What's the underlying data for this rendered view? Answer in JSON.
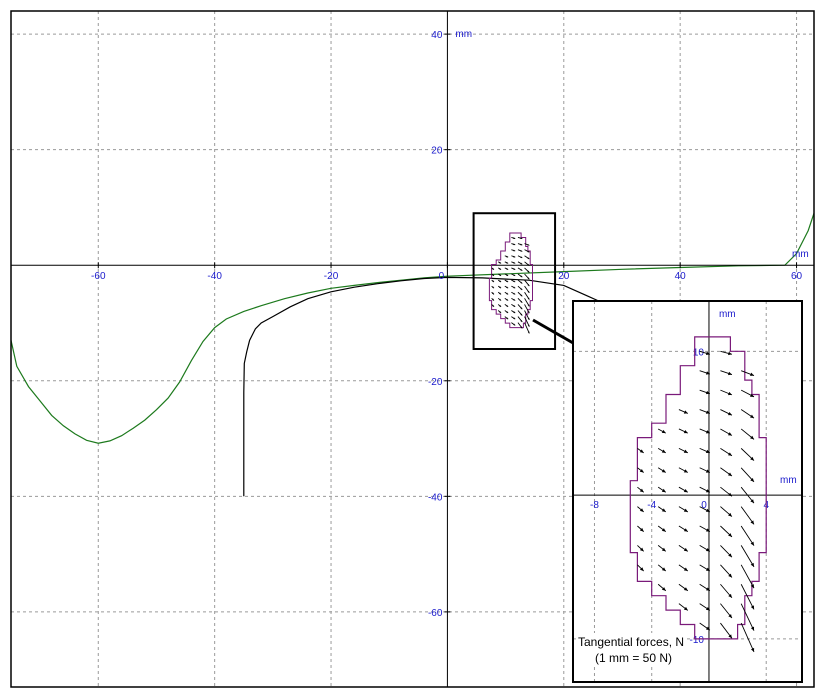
{
  "chart_data": {
    "type": "line",
    "main": {
      "xlim": [
        -75,
        63
      ],
      "ylim": [
        -73,
        44
      ],
      "x_ticks": [
        -60,
        -40,
        -20,
        0,
        20,
        40,
        60
      ],
      "y_ticks": [
        40,
        20,
        -20,
        -40,
        -60
      ],
      "x_unit": "mm",
      "y_unit": "mm",
      "grid": true,
      "series": [
        {
          "color": "#1d7a1d",
          "points": [
            [
              -75,
              -13
            ],
            [
              -74,
              -17.5
            ],
            [
              -72,
              -21
            ],
            [
              -70,
              -23.5
            ],
            [
              -68,
              -26
            ],
            [
              -66,
              -27.8
            ],
            [
              -64,
              -29.2
            ],
            [
              -62,
              -30.3
            ],
            [
              -60,
              -30.8
            ],
            [
              -58,
              -30.4
            ],
            [
              -56,
              -29.5
            ],
            [
              -54,
              -28.2
            ],
            [
              -52,
              -26.8
            ],
            [
              -50,
              -25
            ],
            [
              -48,
              -23
            ],
            [
              -46,
              -20.2
            ],
            [
              -44,
              -16.5
            ],
            [
              -42,
              -13.2
            ],
            [
              -40,
              -10.8
            ],
            [
              -38,
              -9.3
            ],
            [
              -35,
              -8
            ],
            [
              -32,
              -7
            ],
            [
              -28,
              -5.8
            ],
            [
              -24,
              -4.8
            ],
            [
              -20,
              -4
            ],
            [
              -16,
              -3.5
            ],
            [
              -12,
              -3
            ],
            [
              -8,
              -2.6
            ],
            [
              -4,
              -2.2
            ],
            [
              0,
              -1.9
            ],
            [
              10,
              -1.5
            ],
            [
              20,
              -1.1
            ],
            [
              30,
              -0.7
            ],
            [
              40,
              -0.4
            ],
            [
              50,
              -0.1
            ],
            [
              58,
              0
            ],
            [
              60,
              2
            ],
            [
              62,
              6
            ],
            [
              63,
              9
            ]
          ]
        },
        {
          "color": "#000000",
          "points": [
            [
              -35,
              -40
            ],
            [
              -35,
              -22
            ],
            [
              -34.9,
              -17
            ],
            [
              -34.5,
              -15
            ],
            [
              -34,
              -13
            ],
            [
              -33,
              -11
            ],
            [
              -32,
              -10
            ],
            [
              -30,
              -8.9
            ],
            [
              -27,
              -7.2
            ],
            [
              -24,
              -5.8
            ],
            [
              -20,
              -4.6
            ],
            [
              -16,
              -3.8
            ],
            [
              -12,
              -3.2
            ],
            [
              -8,
              -2.7
            ],
            [
              -4,
              -2.3
            ],
            [
              0,
              -2.1
            ],
            [
              6,
              -2.2
            ],
            [
              14,
              -2.6
            ],
            [
              20,
              -3.5
            ],
            [
              24,
              -5.3
            ],
            [
              26,
              -6.2
            ]
          ]
        }
      ]
    },
    "inset": {
      "xlim": [
        -9.5,
        6.5
      ],
      "ylim": [
        -13,
        13.5
      ],
      "x_ticks": [
        -8,
        -4,
        0,
        4
      ],
      "y_ticks": [
        10,
        -10
      ],
      "x_unit": "mm",
      "y_unit": "mm",
      "grid": true,
      "contour_color": "#7a1a7a",
      "contour": [
        [
          -1,
          11
        ],
        [
          1.5,
          11
        ],
        [
          1.5,
          10
        ],
        [
          2.5,
          10
        ],
        [
          2.5,
          8
        ],
        [
          3,
          8
        ],
        [
          3,
          7
        ],
        [
          3.5,
          7
        ],
        [
          3.5,
          4
        ],
        [
          4,
          4
        ],
        [
          4,
          -4
        ],
        [
          3.5,
          -4
        ],
        [
          3.5,
          -6
        ],
        [
          3,
          -6
        ],
        [
          3,
          -7
        ],
        [
          2.5,
          -7
        ],
        [
          2.5,
          -9
        ],
        [
          2,
          -9
        ],
        [
          2,
          -10
        ],
        [
          -1,
          -10
        ],
        [
          -1,
          -9
        ],
        [
          -2,
          -9
        ],
        [
          -2,
          -8
        ],
        [
          -3,
          -8
        ],
        [
          -3,
          -7
        ],
        [
          -4,
          -7
        ],
        [
          -4,
          -6
        ],
        [
          -5,
          -6
        ],
        [
          -5,
          -4
        ],
        [
          -5.5,
          -4
        ],
        [
          -5.5,
          1
        ],
        [
          -5,
          1
        ],
        [
          -5,
          4
        ],
        [
          -4,
          4
        ],
        [
          -4,
          5
        ],
        [
          -3,
          5
        ],
        [
          -3,
          7
        ],
        [
          -2,
          7
        ],
        [
          -2,
          9
        ],
        [
          -1,
          9
        ],
        [
          -1,
          11
        ]
      ],
      "annotation": {
        "line1": "Tangential forces, N",
        "line2": "(1 mm = 50 N)"
      }
    },
    "zoom_box": {
      "x": [
        4.5,
        18.5
      ],
      "y": [
        -14.5,
        9
      ]
    }
  }
}
